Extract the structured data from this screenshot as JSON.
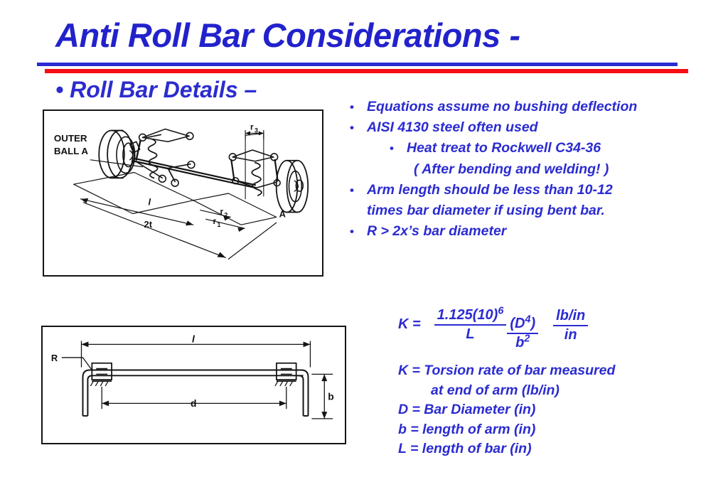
{
  "slide": {
    "title": "Anti Roll Bar Considerations -",
    "subtitle": "• Roll Bar Details –",
    "accent_blue": "#2B2BD2",
    "accent_red": "#F50E14",
    "rule_blue_color": "#2B2BD4",
    "rule_red_color": "#F50E14"
  },
  "bullets": [
    {
      "marker": "•",
      "text": "Equations assume no bushing deflection"
    },
    {
      "marker": "•",
      "text": "AISI 4130 steel often used"
    },
    {
      "marker": "•",
      "text": "Heat treat to Rockwell C34-36"
    },
    {
      "marker": "",
      "text": "( After bending and welding! )"
    },
    {
      "marker": "•",
      "text": "Arm length should be less than 10-12"
    },
    {
      "marker": "",
      "text": "times bar diameter if using bent bar."
    },
    {
      "marker": "•",
      "text": "R > 2x’s bar diameter"
    }
  ],
  "equation": {
    "lhs": "K =",
    "frac1": {
      "numerator": "1.125(10)",
      "numerator_sup": "6",
      "denominator": "L"
    },
    "frac2": {
      "numerator_open": "(D",
      "numerator_sup": "4",
      "numerator_close": ")",
      "denominator": "b",
      "denominator_sup": "2"
    },
    "frac3": {
      "numerator": "lb/in",
      "denominator": "in"
    }
  },
  "legend": [
    "K = Torsion rate of bar measured",
    "at end of arm (lb/in)",
    "D = Bar Diameter (in)",
    "b = length of arm (in)",
    "L = length of bar (in)"
  ],
  "figure_suspension": {
    "caption_label": "OUTER BALL A",
    "dimension_labels": [
      "l",
      "2t",
      "r₁",
      "r₂",
      "r₃",
      "A"
    ],
    "label_outer_ball_line1": "OUTER",
    "label_outer_ball_line2": "BALL A",
    "label_l": "l",
    "label_2t": "2t",
    "label_r1": "r",
    "label_r1_sub": "1",
    "label_r2": "r",
    "label_r2_sub": "2",
    "label_r3": "r",
    "label_r3_sub": "3",
    "label_a": "A"
  },
  "figure_bar": {
    "label_R": "R",
    "label_l": "l",
    "label_d": "d",
    "label_b": "b"
  }
}
